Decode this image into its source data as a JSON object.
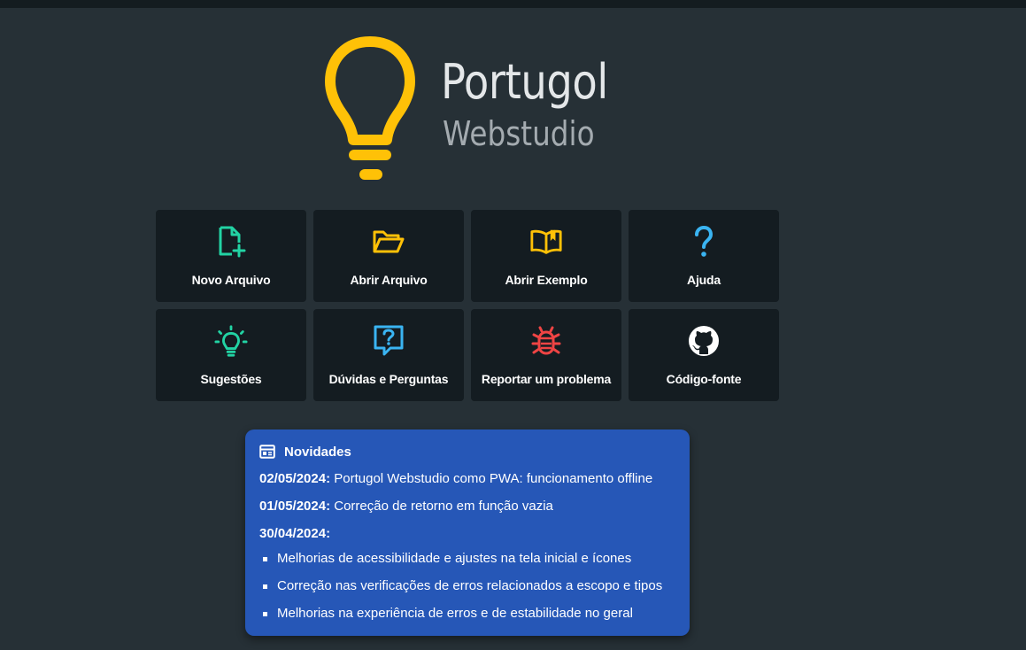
{
  "colors": {
    "background": "#263036",
    "tile_bg": "#141c21",
    "logo_yellow": "#ffc107",
    "news_bg": "#2657b7"
  },
  "logo": {
    "title": "Portugol",
    "subtitle": "Webstudio",
    "icon": "lightbulb-icon"
  },
  "tiles": [
    {
      "label": "Novo Arquivo",
      "icon": "new-file-icon",
      "color": "#22d3a4"
    },
    {
      "label": "Abrir Arquivo",
      "icon": "folder-open-icon",
      "color": "#ffc107"
    },
    {
      "label": "Abrir Exemplo",
      "icon": "book-open-icon",
      "color": "#ffc107"
    },
    {
      "label": "Ajuda",
      "icon": "question-mark-icon",
      "color": "#3ab4f2"
    },
    {
      "label": "Sugestões",
      "icon": "lightbulb-idea-icon",
      "color": "#22d3a4"
    },
    {
      "label": "Dúvidas e Perguntas",
      "icon": "question-chat-icon",
      "color": "#3ab4f2"
    },
    {
      "label": "Reportar um problema",
      "icon": "bug-icon",
      "color": "#ef4444"
    },
    {
      "label": "Código-fonte",
      "icon": "github-icon",
      "color": "#ffffff"
    }
  ],
  "news": {
    "title": "Novidades",
    "icon": "newspaper-icon",
    "entries": [
      {
        "date": "02/05/2024:",
        "text": " Portugol Webstudio como PWA: funcionamento offline"
      },
      {
        "date": "01/05/2024:",
        "text": " Correção de retorno em função vazia"
      },
      {
        "date": "30/04/2024:",
        "text": ""
      }
    ],
    "items": [
      "Melhorias de acessibilidade e ajustes na tela inicial e ícones",
      "Correção nas verificações de erros relacionados a escopo e tipos",
      "Melhorias na experiência de erros e de estabilidade no geral"
    ]
  }
}
